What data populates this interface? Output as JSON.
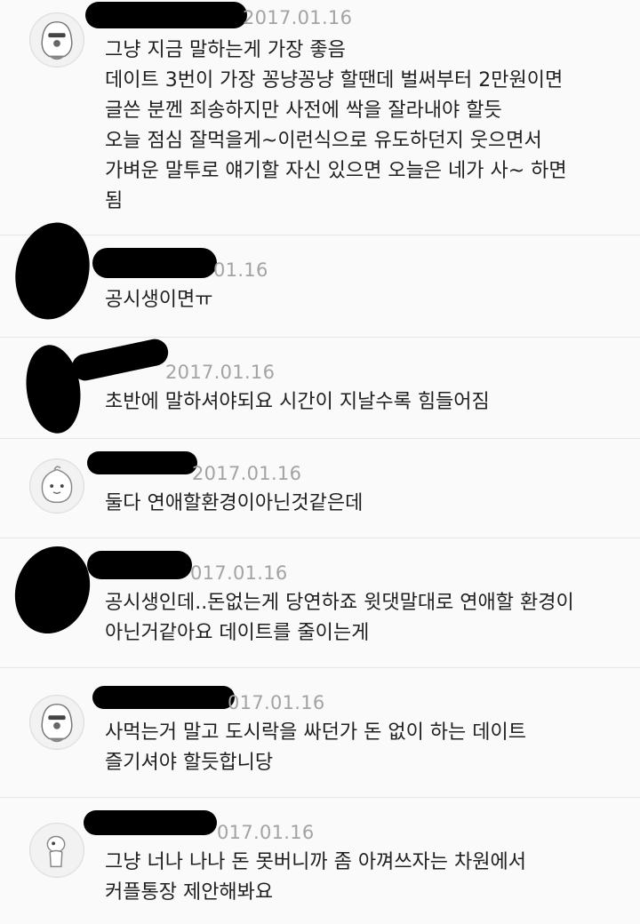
{
  "comments": [
    {
      "date": "2017.01.16",
      "avatar_icon": "character-avatar-icon",
      "text": "그냥 지금 말하는게 가장 좋음\n데이트 3번이 가장 꽁냥꽁냥 할땐데 벌써부터 2만원이면\n글쓴 분껜 죄송하지만 사전에 싹을 잘라내야 할듯\n오늘 점심 잘먹을게~이런식으로 유도하던지 웃으면서\n가벼운 말투로 얘기할 자신 있으면 오늘은 네가 사~ 하면\n됨"
    },
    {
      "date": "01.16",
      "avatar_icon": "redacted-avatar",
      "text": "공시생이면ㅠ"
    },
    {
      "date": "2017.01.16",
      "avatar_icon": "redacted-avatar",
      "text": "초반에 말하셔야되요 시간이 지날수록 힘들어짐"
    },
    {
      "date": "2017.01.16",
      "avatar_icon": "peach-character-avatar-icon",
      "text": "둘다 연애할환경이아닌것같은데"
    },
    {
      "date": "017.01.16",
      "avatar_icon": "redacted-avatar",
      "text": "공시생인데..돈없는게 당연하죠 윗댓말대로 연애할 환경이\n아닌거같아요 데이트를 줄이는게"
    },
    {
      "date": "017.01.16",
      "avatar_icon": "character-avatar-icon",
      "text": "사먹는거 말고 도시락을 싸던가 돈 없이 하는 데이트\n즐기셔야 할듯합니당"
    },
    {
      "date": "017.01.16",
      "avatar_icon": "figure-character-avatar-icon",
      "text": "그냥 너나 나나 돈 못버니까 좀 아껴쓰자는 차원에서\n커플통장 제안해봐요"
    }
  ]
}
